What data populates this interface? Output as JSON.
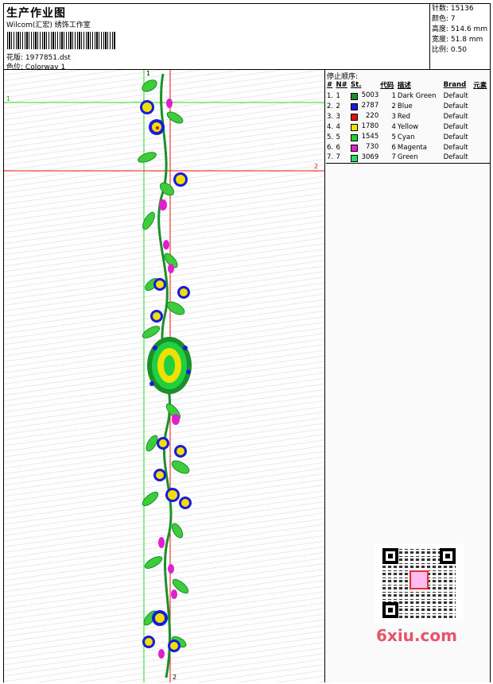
{
  "header": {
    "title": "生产作业图",
    "subtitle": "Wilcom(汇宏) 绣饰工作室",
    "design_label": "花版:",
    "design_value": "1977851.dst",
    "colorway_label": "色位:",
    "colorway_value": "Colorway 1"
  },
  "stats": [
    {
      "label": "针数:",
      "value": "15136"
    },
    {
      "label": "颜色:",
      "value": "7"
    },
    {
      "label": "高度:",
      "value": "514.6 mm"
    },
    {
      "label": "宽度:",
      "value": "51.8 mm"
    },
    {
      "label": "比例:",
      "value": "0.50"
    }
  ],
  "stop_sequence": {
    "title": "停止顺序:",
    "columns": [
      "#",
      "N#",
      "St.",
      "代码",
      "描述",
      "Brand",
      "元素"
    ],
    "rows": [
      {
        "idx": "1.",
        "n": "1",
        "color": "#1a8f2a",
        "st": "5003",
        "code": "1",
        "desc": "Dark Green",
        "brand": "Default"
      },
      {
        "idx": "2.",
        "n": "2",
        "color": "#1a1adf",
        "st": "2787",
        "code": "2",
        "desc": "Blue",
        "brand": "Default"
      },
      {
        "idx": "3.",
        "n": "3",
        "color": "#e01010",
        "st": "220",
        "code": "3",
        "desc": "Red",
        "brand": "Default"
      },
      {
        "idx": "4.",
        "n": "4",
        "color": "#f0e000",
        "st": "1780",
        "code": "4",
        "desc": "Yellow",
        "brand": "Default"
      },
      {
        "idx": "5.",
        "n": "5",
        "color": "#20d040",
        "st": "1545",
        "code": "5",
        "desc": "Cyan",
        "brand": "Default"
      },
      {
        "idx": "6.",
        "n": "6",
        "color": "#e020d0",
        "st": "730",
        "code": "6",
        "desc": "Magenta",
        "brand": "Default"
      },
      {
        "idx": "7.",
        "n": "7",
        "color": "#20e060",
        "st": "3069",
        "code": "7",
        "desc": "Green",
        "brand": "Default"
      }
    ]
  },
  "guides": {
    "v1": "1",
    "h1": "1",
    "h2": "2",
    "v2": "2"
  },
  "watermark": {
    "brand": "6xiu.com"
  },
  "colors": {
    "guide_green": "#22dd22",
    "guide_red": "#ee1111"
  }
}
